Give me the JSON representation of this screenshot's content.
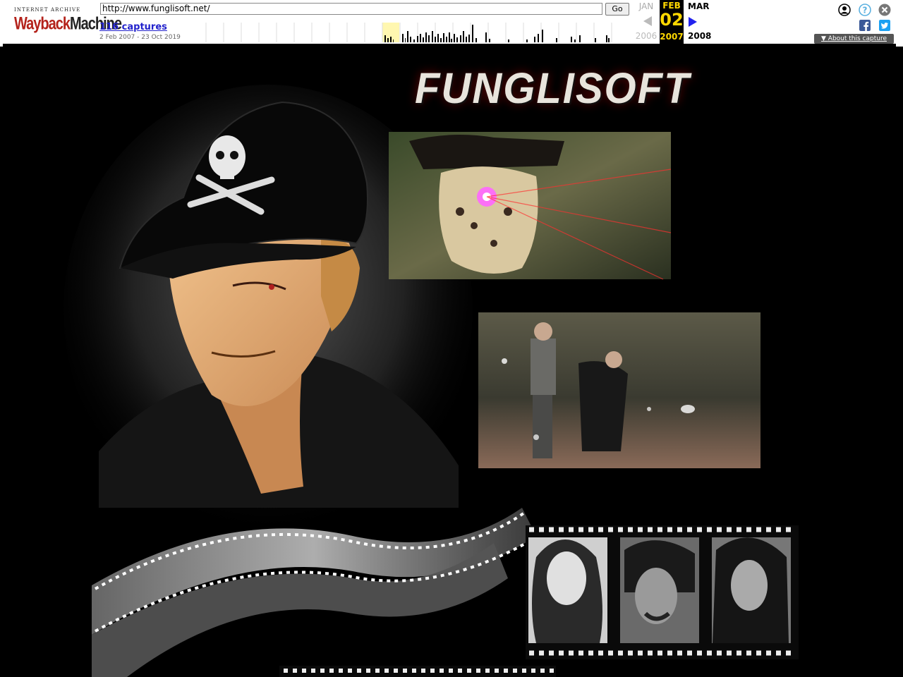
{
  "wayback": {
    "logo_top": "INTERNET ARCHIVE",
    "logo_wordmark": "WaybackMachine",
    "logo_wordmark_parts": [
      "Wayback",
      "Machine"
    ],
    "url": "http://www.funglisoft.net/",
    "go_label": "Go",
    "captures_label": "116 captures",
    "date_range": "2 Feb 2007 - 23 Oct 2019",
    "prev_month": "JAN",
    "prev_year": "2006",
    "current_month": "FEB",
    "current_day": "02",
    "current_year": "2007",
    "next_month": "MAR",
    "next_year": "2008",
    "about_label": "About this capture",
    "icons": [
      "account-icon",
      "help-icon",
      "close-icon",
      "facebook-icon",
      "twitter-icon"
    ],
    "colors": {
      "highlight": "#ffd800",
      "link": "#2222cc",
      "logo_red": "#b4221b"
    }
  },
  "site": {
    "logo_text": "FUNGLISOFT",
    "background": "#000000"
  }
}
